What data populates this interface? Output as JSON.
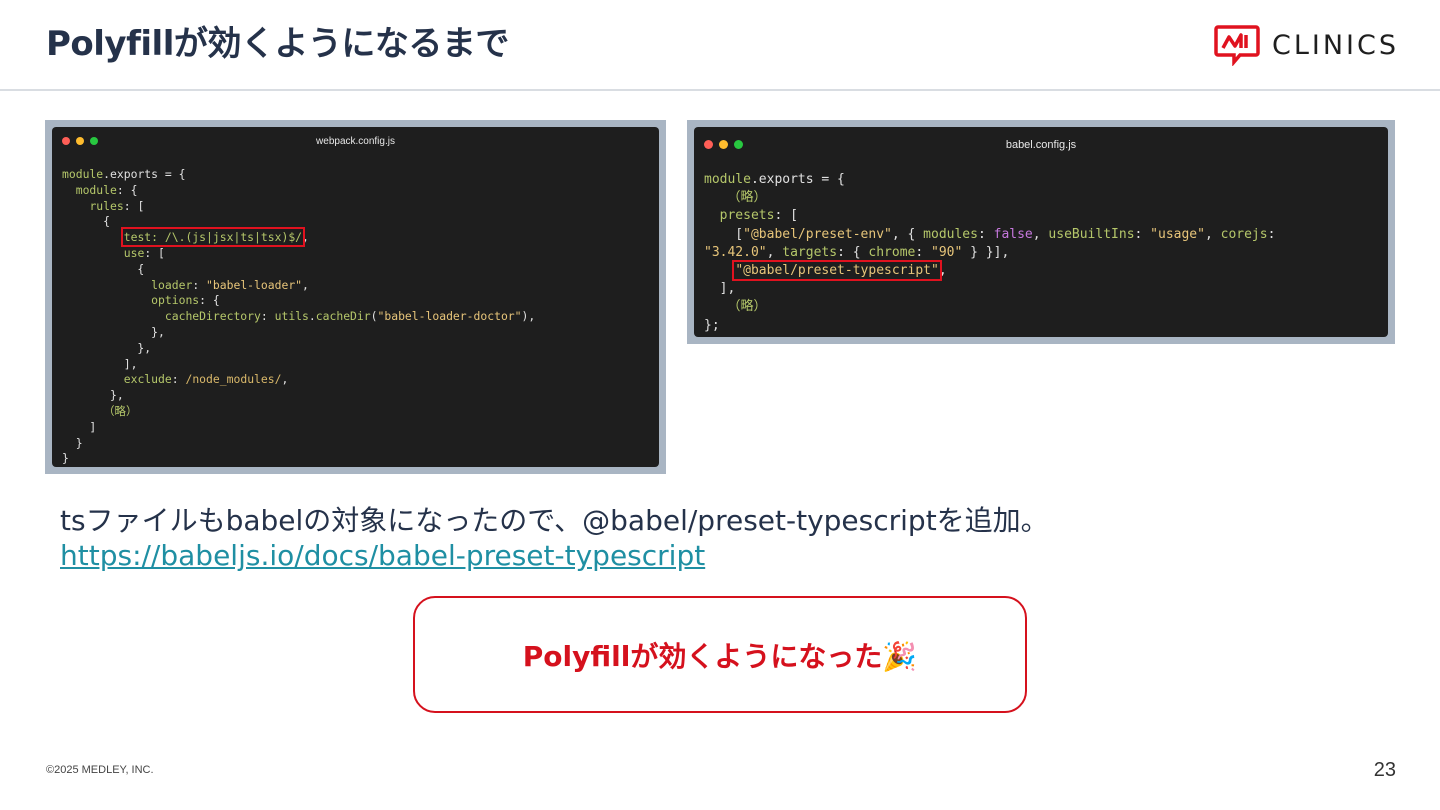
{
  "title": "Polyfillが効くようになるまで",
  "logo": {
    "text": "CLINICS",
    "brand_color": "#e0121f"
  },
  "window_dots": [
    "#ff5f57",
    "#febc2e",
    "#28c840"
  ],
  "webpack_window": {
    "title": "webpack.config.js",
    "lines": [
      [
        [
          "k",
          "module"
        ],
        [
          "p",
          ".exports = {"
        ]
      ],
      [
        [
          "p",
          "  "
        ],
        [
          "k",
          "module"
        ],
        [
          "p",
          ": {"
        ]
      ],
      [
        [
          "p",
          "    "
        ],
        [
          "k",
          "rules"
        ],
        [
          "p",
          ": ["
        ]
      ],
      [
        [
          "p",
          "      {"
        ]
      ],
      [
        [
          "p",
          "         "
        ],
        [
          "hl",
          "test: /\\.(js|jsx|ts|tsx)$/"
        ],
        [
          "p",
          ","
        ]
      ],
      [
        [
          "p",
          "         "
        ],
        [
          "k",
          "use"
        ],
        [
          "p",
          ": ["
        ]
      ],
      [
        [
          "p",
          "           {"
        ]
      ],
      [
        [
          "p",
          "             "
        ],
        [
          "k",
          "loader"
        ],
        [
          "p",
          ": "
        ],
        [
          "s",
          "\"babel-loader\""
        ],
        [
          "p",
          ","
        ]
      ],
      [
        [
          "p",
          "             "
        ],
        [
          "k",
          "options"
        ],
        [
          "p",
          ": {"
        ]
      ],
      [
        [
          "p",
          "               "
        ],
        [
          "k",
          "cacheDirectory"
        ],
        [
          "p",
          ": "
        ],
        [
          "k",
          "utils"
        ],
        [
          "p",
          "."
        ],
        [
          "k",
          "cacheDir"
        ],
        [
          "p",
          "("
        ],
        [
          "s",
          "\"babel-loader-doctor\""
        ],
        [
          "p",
          "),"
        ]
      ],
      [
        [
          "p",
          "             },"
        ]
      ],
      [
        [
          "p",
          "           },"
        ]
      ],
      [
        [
          "p",
          "         ],"
        ]
      ],
      [
        [
          "p",
          "         "
        ],
        [
          "k",
          "exclude"
        ],
        [
          "p",
          ": "
        ],
        [
          "r",
          "/node_modules/"
        ],
        [
          "p",
          ","
        ]
      ],
      [
        [
          "p",
          "       },"
        ]
      ],
      [
        [
          "p",
          "      "
        ],
        [
          "k",
          "（略）"
        ]
      ],
      [
        [
          "p",
          "    ]"
        ]
      ],
      [
        [
          "p",
          "  }"
        ]
      ],
      [
        [
          "p",
          "}"
        ]
      ]
    ]
  },
  "babel_window": {
    "title": "babel.config.js",
    "lines": [
      [
        [
          "k",
          "module"
        ],
        [
          "p",
          ".exports = {"
        ]
      ],
      [
        [
          "p",
          "   "
        ],
        [
          "k",
          "（略）"
        ]
      ],
      [
        [
          "p",
          "  "
        ],
        [
          "k",
          "presets"
        ],
        [
          "p",
          ": ["
        ]
      ],
      [
        [
          "p",
          "    ["
        ],
        [
          "s",
          "\"@babel/preset-env\""
        ],
        [
          "p",
          ", { "
        ],
        [
          "k",
          "modules"
        ],
        [
          "p",
          ": "
        ],
        [
          "b",
          "false"
        ],
        [
          "p",
          ", "
        ],
        [
          "k",
          "useBuiltIns"
        ],
        [
          "p",
          ": "
        ],
        [
          "s",
          "\"usage\""
        ],
        [
          "p",
          ", "
        ],
        [
          "k",
          "corejs"
        ],
        [
          "p",
          ":"
        ]
      ],
      [
        [
          "s",
          "\"3.42.0\""
        ],
        [
          "p",
          ", "
        ],
        [
          "k",
          "targets"
        ],
        [
          "p",
          ": { "
        ],
        [
          "k",
          "chrome"
        ],
        [
          "p",
          ": "
        ],
        [
          "s",
          "\"90\""
        ],
        [
          "p",
          " } }],"
        ]
      ],
      [
        [
          "p",
          "    "
        ],
        [
          "hls",
          "\"@babel/preset-typescript\""
        ],
        [
          "p",
          ","
        ]
      ],
      [
        [
          "p",
          "  ],"
        ]
      ],
      [
        [
          "p",
          "   "
        ],
        [
          "k",
          "（略）"
        ]
      ],
      [
        [
          "p",
          "};"
        ]
      ]
    ]
  },
  "body_text": "tsファイルもbabelの対象になったので、@babel/preset-typescriptを追加。",
  "body_link": "https://babeljs.io/docs/babel-preset-typescript",
  "callout_text": "Polyfillが効くようになった🎉",
  "footer_copyright": "©2025 MEDLEY, INC.",
  "page_number": "23"
}
